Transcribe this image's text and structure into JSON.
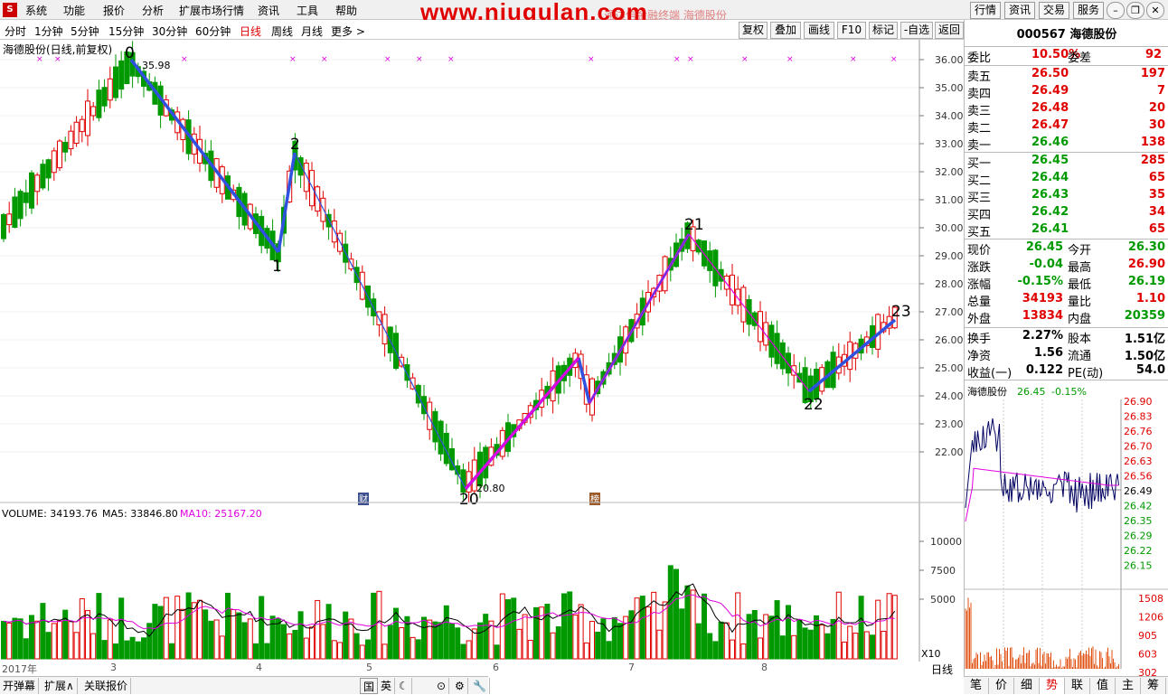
{
  "menu": {
    "logo_glyph": "S",
    "items": [
      "系统",
      "功能",
      "报价",
      "分析",
      "扩展市场行情",
      "资讯",
      "工具",
      "帮助"
    ],
    "right_buttons": [
      "行情",
      "资讯",
      "交易",
      "服务"
    ]
  },
  "watermark": {
    "text": "www.niugulan.com",
    "sub": "通达信金融终端  海德股份"
  },
  "periods": [
    "分时",
    "1分钟",
    "5分钟",
    "15分钟",
    "30分钟",
    "60分钟",
    "日线",
    "周线",
    "月线",
    "更多 >"
  ],
  "active_period": "日线",
  "tools": [
    "复权",
    "叠加",
    "画线",
    "F10",
    "标记",
    "-自选",
    "返回"
  ],
  "chart": {
    "label": "海德股份(日线,前复权)",
    "high_label": "35.98",
    "low_label": "20.80",
    "price_axis": [
      "36.00",
      "35.00",
      "34.00",
      "33.00",
      "32.00",
      "31.00",
      "30.00",
      "29.00",
      "28.00",
      "27.00",
      "26.00",
      "25.00",
      "24.00",
      "23.00",
      "22.00"
    ],
    "wave_labels": [
      "0",
      "1",
      "2",
      "20",
      "21",
      "22",
      "23"
    ],
    "volume_label": "VOLUME: 34193.76",
    "ma5_label": "MA5: 33846.80",
    "ma10_label": "MA10: 25167.20",
    "vol_axis": [
      "10000",
      "7500",
      "5000"
    ],
    "vol_unit": "X10",
    "months": [
      "2017年",
      "3",
      "4",
      "5",
      "6",
      "7",
      "8"
    ],
    "period_tag": "日线",
    "marker_cai": "财",
    "marker_bang": "榜"
  },
  "stock": {
    "code": "000567",
    "name": "海德股份"
  },
  "quote": {
    "weibi_label": "委比",
    "weibi": "10.50%",
    "weicha_label": "委差",
    "weicha": "92",
    "asks": [
      {
        "label": "卖五",
        "price": "26.50",
        "vol": "197"
      },
      {
        "label": "卖四",
        "price": "26.49",
        "vol": "7"
      },
      {
        "label": "卖三",
        "price": "26.48",
        "vol": "20"
      },
      {
        "label": "卖二",
        "price": "26.47",
        "vol": "30"
      },
      {
        "label": "卖一",
        "price": "26.46",
        "vol": "138"
      }
    ],
    "bids": [
      {
        "label": "买一",
        "price": "26.45",
        "vol": "285"
      },
      {
        "label": "买二",
        "price": "26.44",
        "vol": "65"
      },
      {
        "label": "买三",
        "price": "26.43",
        "vol": "35"
      },
      {
        "label": "买四",
        "price": "26.42",
        "vol": "34"
      },
      {
        "label": "买五",
        "price": "26.41",
        "vol": "65"
      }
    ],
    "stats": [
      {
        "l1": "现价",
        "v1": "26.45",
        "c1": "green",
        "l2": "今开",
        "v2": "26.30",
        "c2": "green"
      },
      {
        "l1": "涨跌",
        "v1": "-0.04",
        "c1": "green",
        "l2": "最高",
        "v2": "26.90",
        "c2": "red"
      },
      {
        "l1": "涨幅",
        "v1": "-0.15%",
        "c1": "green",
        "l2": "最低",
        "v2": "26.19",
        "c2": "green"
      },
      {
        "l1": "总量",
        "v1": "34193",
        "c1": "red",
        "l2": "量比",
        "v2": "1.10",
        "c2": "red"
      },
      {
        "l1": "外盘",
        "v1": "13834",
        "c1": "red",
        "l2": "内盘",
        "v2": "20359",
        "c2": "green"
      }
    ],
    "fin": [
      {
        "l1": "换手",
        "v1": "2.27%",
        "l2": "股本",
        "v2": "1.51亿"
      },
      {
        "l1": "净资",
        "v1": "1.56",
        "l2": "流通",
        "v2": "1.50亿"
      },
      {
        "l1": "收益(一)",
        "v1": "0.122",
        "l2": "PE(动)",
        "v2": "54.0"
      }
    ]
  },
  "mini": {
    "name": "海德股份",
    "price": "26.45",
    "change": "-0.15%",
    "axis": [
      "26.90",
      "26.83",
      "26.76",
      "26.70",
      "26.63",
      "26.56",
      "26.49",
      "26.42",
      "26.35",
      "26.29",
      "26.22",
      "26.15"
    ],
    "vol_axis": [
      "1508",
      "1206",
      "905",
      "603",
      "302"
    ]
  },
  "bottom_tabs": [
    "笔",
    "价",
    "细",
    "势",
    "联",
    "值",
    "主",
    "筹"
  ],
  "active_tab": "势",
  "status": [
    "开弹幕",
    "扩展∧",
    "关联报价"
  ],
  "status_icons": [
    "国",
    "英",
    "☾",
    "⊙",
    "⚙",
    "🔧"
  ],
  "colors": {
    "up": "#e00000",
    "down": "#009900",
    "wave": "#3050e0",
    "ma": "#e000e0",
    "accent": "#e00000"
  }
}
